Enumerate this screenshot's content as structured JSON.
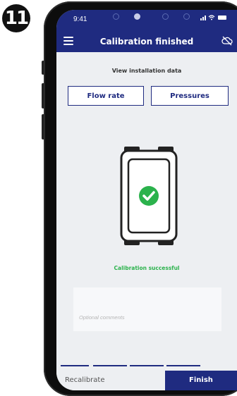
{
  "step_number": "11",
  "status_bar": {
    "time": "9:41",
    "icons": "…ᴵ ▮"
  },
  "header": {
    "title": "Calibration finished",
    "menu_icon": "hamburger-icon",
    "right_icon": "cloud-off-icon"
  },
  "installation": {
    "label": "View installation data",
    "flow_rate_label": "Flow rate",
    "pressures_label": "Pressures"
  },
  "device_status": {
    "icon": "check-circle-icon",
    "message": "Calibration successful"
  },
  "comments": {
    "placeholder": "Optional comments"
  },
  "footer": {
    "recalibrate_label": "Recalibrate",
    "finish_label": "Finish"
  },
  "colors": {
    "brand": "#1f2b80",
    "success": "#2bb24c",
    "background": "#edeff2"
  }
}
